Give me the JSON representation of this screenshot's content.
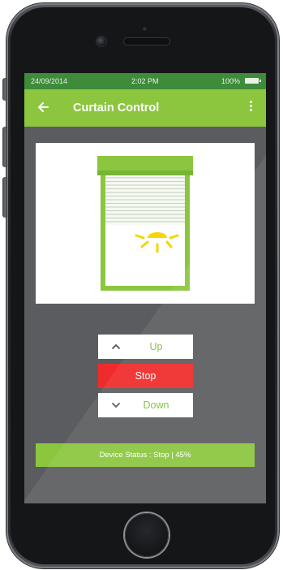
{
  "status_bar": {
    "date": "24/09/2014",
    "time": "2:02 PM",
    "battery": "100%"
  },
  "app_bar": {
    "title": "Curtain Control",
    "back_icon": "arrow-left-icon",
    "menu_icon": "more-vertical-icon"
  },
  "illustration": {
    "curtain_position_percent": 45,
    "frame_color": "#8cc63f",
    "sun_color": "#f5d600"
  },
  "controls": {
    "up_label": "Up",
    "up_icon": "chevron-up-icon",
    "stop_label": "Stop",
    "down_label": "Down",
    "down_icon": "chevron-down-icon"
  },
  "device_status": {
    "text": "Device Status : Stop | 45%"
  },
  "colors": {
    "accent": "#8cc63f",
    "status_bar": "#3e8b3a",
    "stop": "#ef2b2b",
    "screen_bg": "#5b5c5f"
  }
}
